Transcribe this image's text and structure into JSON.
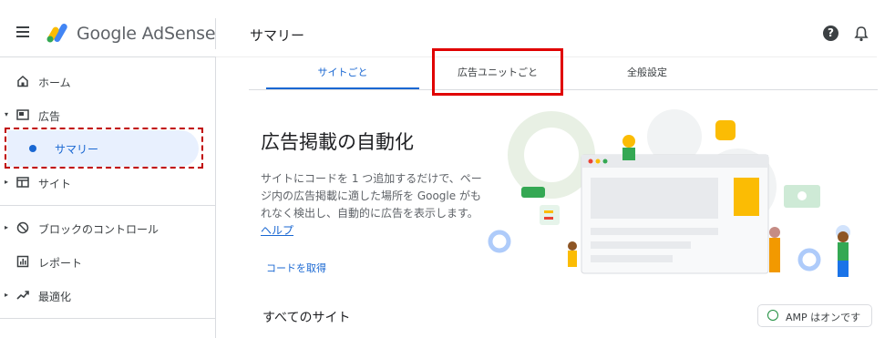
{
  "header": {
    "app_name": "Google AdSense",
    "page_title": "サマリー"
  },
  "sidebar": {
    "items": [
      {
        "label": "ホーム",
        "icon": "home-icon"
      },
      {
        "label": "広告",
        "icon": "ad-unit-icon"
      },
      {
        "label": "サマリー",
        "icon": "dot"
      },
      {
        "label": "サイト",
        "icon": "sites-icon"
      },
      {
        "label": "ブロックのコントロール",
        "icon": "block-icon"
      },
      {
        "label": "レポート",
        "icon": "report-icon"
      },
      {
        "label": "最適化",
        "icon": "trending-icon"
      }
    ]
  },
  "tabs": [
    {
      "label": "サイトごと"
    },
    {
      "label": "広告ユニットごと"
    },
    {
      "label": "全般設定"
    }
  ],
  "main": {
    "hero_title": "広告掲載の自動化",
    "hero_desc": "サイトにコードを 1 つ追加するだけで、ページ内の広告掲載に適した場所を Google がもれなく検出し、自動的に広告を表示します。",
    "help_link": "ヘルプ",
    "get_code": "コードを取得",
    "all_sites": "すべてのサイト",
    "amp_badge": "AMP はオンです"
  },
  "colors": {
    "accent": "#1967d2",
    "highlight_red": "#e00000",
    "selected_bg": "#e8f0fe"
  }
}
